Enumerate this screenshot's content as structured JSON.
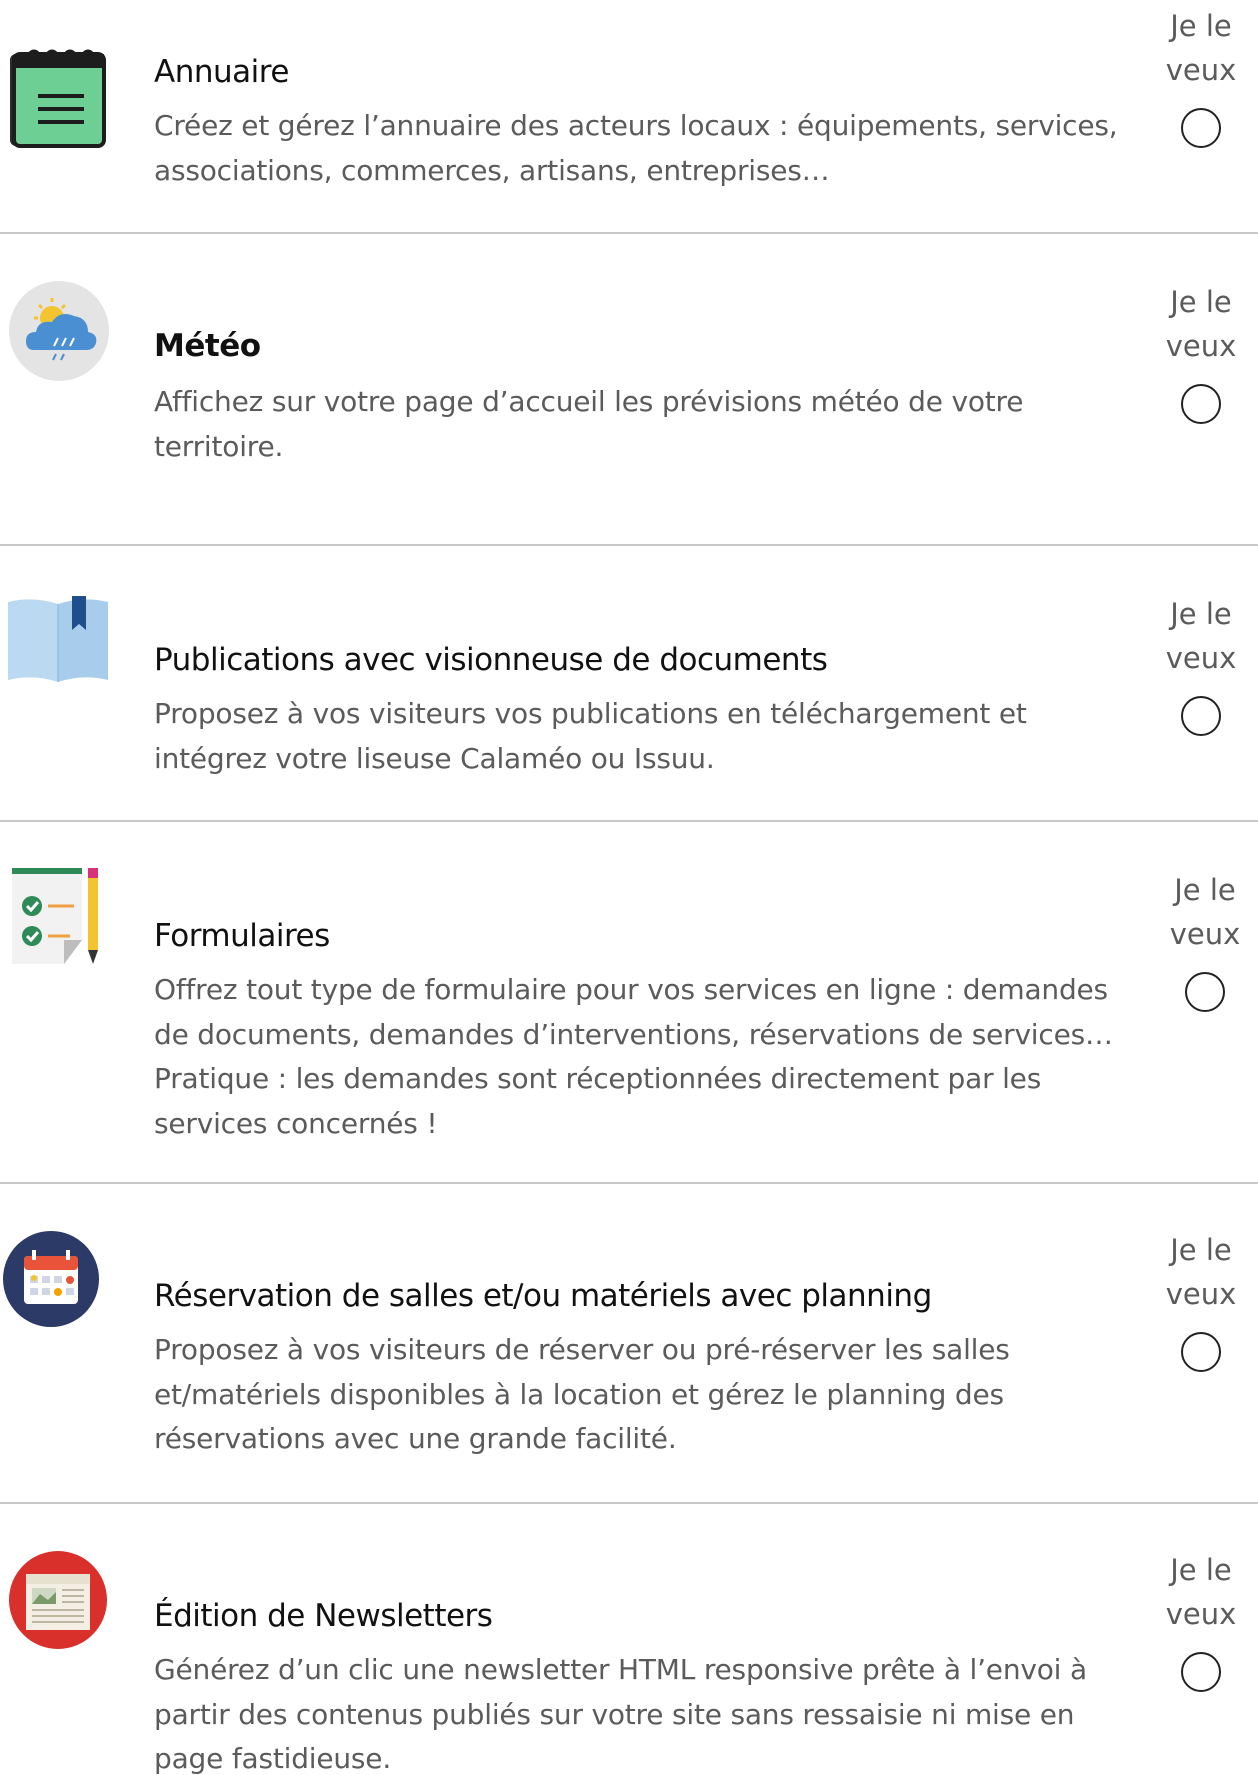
{
  "modules": [
    {
      "title": "Annuaire",
      "description": "Créez et gérez l’annuaire des acteurs locaux : équipements, services, associations, commerces, artisans, entreprises…",
      "want_label": "Je le veux",
      "icon": "notepad-icon",
      "title_bold": false
    },
    {
      "title": "Météo",
      "description": "Affichez sur votre page d’accueil les prévisions météo de votre territoire.",
      "want_label": "Je le veux",
      "icon": "weather-icon",
      "title_bold": true
    },
    {
      "title": "Publications avec visionneuse de documents",
      "description": "Proposez à vos visiteurs vos publications en téléchargement et intégrez votre liseuse Calaméo ou Issuu.",
      "want_label": "Je le veux",
      "icon": "open-book-icon",
      "title_bold": false
    },
    {
      "title": "Formulaires",
      "description": "Offrez tout type de formulaire pour vos services en ligne : demandes de documents, demandes d’interventions, réservations de services… Pratique : les demandes sont réceptionnées directement par les services concernés !",
      "want_label": "Je le veux",
      "icon": "form-checklist-icon",
      "title_bold": false
    },
    {
      "title": "Réservation de salles et/ou matériels avec planning",
      "description": "Proposez à vos visiteurs de réserver ou pré-réserver les salles et/matériels disponibles à la location et gérez le planning des réservations avec une grande facilité.",
      "want_label": "Je le veux",
      "icon": "calendar-icon",
      "title_bold": false
    },
    {
      "title": "Édition de Newsletters",
      "description": "Générez d’un clic une newsletter HTML responsive prête à l’envoi à partir des contenus publiés sur votre site sans ressaisie ni mise en page fastidieuse.",
      "want_label": "Je le veux",
      "icon": "newspaper-icon",
      "title_bold": false
    }
  ],
  "colors": {
    "divider": "#c9c9c9",
    "title_text": "#111111",
    "description_text": "#5b5b5b",
    "notepad_green": "#6dcf93",
    "calendar_navy": "#2b3a67",
    "newsletter_red": "#d9302b"
  }
}
